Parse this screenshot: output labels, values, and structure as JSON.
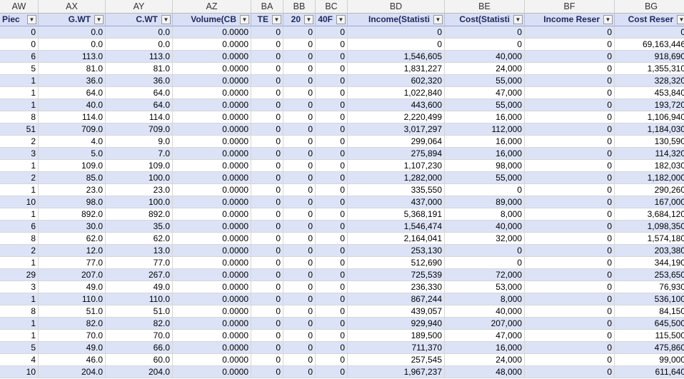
{
  "column_letters": [
    "AW",
    "AX",
    "AY",
    "AZ",
    "BA",
    "BB",
    "BC",
    "BD",
    "BE",
    "BF",
    "BG"
  ],
  "headers": [
    "Piec",
    "G.WT",
    "C.WT",
    "Volume(CB",
    "TE",
    "20",
    "40F",
    "Income(Statisti",
    "Cost(Statisti",
    "Income Reser",
    "Cost Reser"
  ],
  "filter_icon": "dropdown-arrow-icon",
  "filter_glyph": "▼",
  "colors": {
    "header_band": "#d9dff4",
    "row_shade": "#dce3f7",
    "header_text": "#1f2a60",
    "grid": "#d6d6d6"
  },
  "rows": [
    [
      "0",
      "0.0",
      "0.0",
      "0.0000",
      "0",
      "0",
      "0",
      "0",
      "0",
      "0",
      "0"
    ],
    [
      "0",
      "0.0",
      "0.0",
      "0.0000",
      "0",
      "0",
      "0",
      "0",
      "0",
      "0",
      "69,163,446"
    ],
    [
      "6",
      "113.0",
      "113.0",
      "0.0000",
      "0",
      "0",
      "0",
      "1,546,605",
      "40,000",
      "0",
      "918,690"
    ],
    [
      "5",
      "81.0",
      "81.0",
      "0.0000",
      "0",
      "0",
      "0",
      "1,831,227",
      "24,000",
      "0",
      "1,355,310"
    ],
    [
      "1",
      "36.0",
      "36.0",
      "0.0000",
      "0",
      "0",
      "0",
      "602,320",
      "55,000",
      "0",
      "328,320"
    ],
    [
      "1",
      "64.0",
      "64.0",
      "0.0000",
      "0",
      "0",
      "0",
      "1,022,840",
      "47,000",
      "0",
      "453,840"
    ],
    [
      "1",
      "40.0",
      "64.0",
      "0.0000",
      "0",
      "0",
      "0",
      "443,600",
      "55,000",
      "0",
      "193,720"
    ],
    [
      "8",
      "114.0",
      "114.0",
      "0.0000",
      "0",
      "0",
      "0",
      "2,220,499",
      "16,000",
      "0",
      "1,106,940"
    ],
    [
      "51",
      "709.0",
      "709.0",
      "0.0000",
      "0",
      "0",
      "0",
      "3,017,297",
      "112,000",
      "0",
      "1,184,030"
    ],
    [
      "2",
      "4.0",
      "9.0",
      "0.0000",
      "0",
      "0",
      "0",
      "299,064",
      "16,000",
      "0",
      "130,590"
    ],
    [
      "3",
      "5.0",
      "7.0",
      "0.0000",
      "0",
      "0",
      "0",
      "275,894",
      "16,000",
      "0",
      "114,320"
    ],
    [
      "1",
      "109.0",
      "109.0",
      "0.0000",
      "0",
      "0",
      "0",
      "1,107,230",
      "98,000",
      "0",
      "182,030"
    ],
    [
      "2",
      "85.0",
      "100.0",
      "0.0000",
      "0",
      "0",
      "0",
      "1,282,000",
      "55,000",
      "0",
      "1,182,000"
    ],
    [
      "1",
      "23.0",
      "23.0",
      "0.0000",
      "0",
      "0",
      "0",
      "335,550",
      "0",
      "0",
      "290,260"
    ],
    [
      "10",
      "98.0",
      "100.0",
      "0.0000",
      "0",
      "0",
      "0",
      "437,000",
      "89,000",
      "0",
      "167,000"
    ],
    [
      "1",
      "892.0",
      "892.0",
      "0.0000",
      "0",
      "0",
      "0",
      "5,368,191",
      "8,000",
      "0",
      "3,684,120"
    ],
    [
      "6",
      "30.0",
      "35.0",
      "0.0000",
      "0",
      "0",
      "0",
      "1,546,474",
      "40,000",
      "0",
      "1,098,350"
    ],
    [
      "8",
      "62.0",
      "62.0",
      "0.0000",
      "0",
      "0",
      "0",
      "2,164,041",
      "32,000",
      "0",
      "1,574,180"
    ],
    [
      "2",
      "12.0",
      "13.0",
      "0.0000",
      "0",
      "0",
      "0",
      "253,130",
      "0",
      "0",
      "203,380"
    ],
    [
      "1",
      "77.0",
      "77.0",
      "0.0000",
      "0",
      "0",
      "0",
      "512,690",
      "0",
      "0",
      "344,190"
    ],
    [
      "29",
      "207.0",
      "267.0",
      "0.0000",
      "0",
      "0",
      "0",
      "725,539",
      "72,000",
      "0",
      "253,650"
    ],
    [
      "3",
      "49.0",
      "49.0",
      "0.0000",
      "0",
      "0",
      "0",
      "236,330",
      "53,000",
      "0",
      "76,930"
    ],
    [
      "1",
      "110.0",
      "110.0",
      "0.0000",
      "0",
      "0",
      "0",
      "867,244",
      "8,000",
      "0",
      "536,100"
    ],
    [
      "8",
      "51.0",
      "51.0",
      "0.0000",
      "0",
      "0",
      "0",
      "439,057",
      "40,000",
      "0",
      "84,150"
    ],
    [
      "1",
      "82.0",
      "82.0",
      "0.0000",
      "0",
      "0",
      "0",
      "929,940",
      "207,000",
      "0",
      "645,500"
    ],
    [
      "1",
      "70.0",
      "70.0",
      "0.0000",
      "0",
      "0",
      "0",
      "189,500",
      "47,000",
      "0",
      "115,500"
    ],
    [
      "5",
      "49.0",
      "66.0",
      "0.0000",
      "0",
      "0",
      "0",
      "711,370",
      "16,000",
      "0",
      "475,860"
    ],
    [
      "4",
      "46.0",
      "60.0",
      "0.0000",
      "0",
      "0",
      "0",
      "257,545",
      "24,000",
      "0",
      "99,000"
    ],
    [
      "10",
      "204.0",
      "204.0",
      "0.0000",
      "0",
      "0",
      "0",
      "1,967,237",
      "48,000",
      "0",
      "611,640"
    ]
  ]
}
